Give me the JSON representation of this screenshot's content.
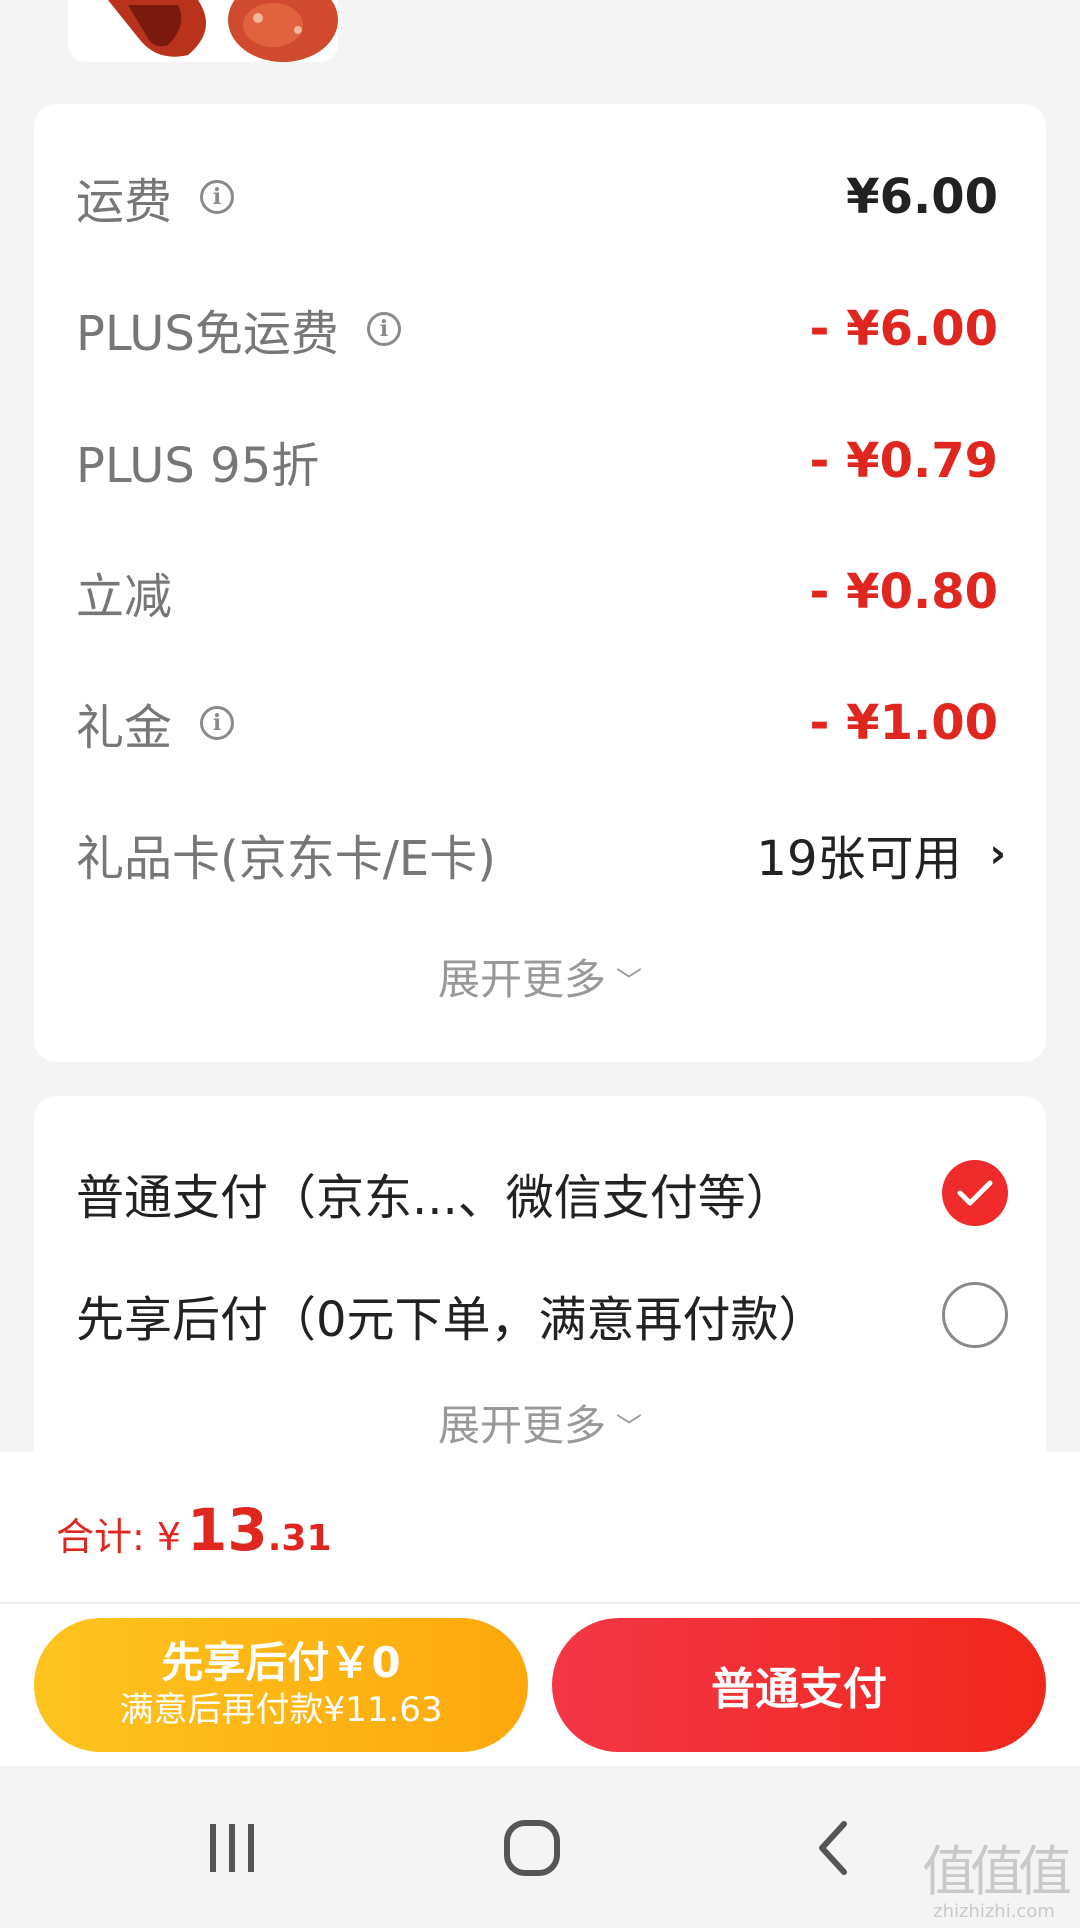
{
  "fees": [
    {
      "label": "运费",
      "info": true,
      "value": "¥6.00",
      "red": false
    },
    {
      "label": "PLUS免运费",
      "info": true,
      "value": "- ¥6.00",
      "red": true
    },
    {
      "label": "PLUS 95折",
      "info": false,
      "value": "- ¥0.79",
      "red": true
    },
    {
      "label": "立减",
      "info": false,
      "value": "- ¥0.80",
      "red": true
    },
    {
      "label": "礼金",
      "info": true,
      "value": "- ¥1.00",
      "red": true
    }
  ],
  "gift_card": {
    "label": "礼品卡(京东卡/E卡)",
    "value": "19张可用"
  },
  "expand_more_label": "展开更多",
  "payment_options": [
    {
      "label": "普通支付（京东...、微信支付等）",
      "selected": true
    },
    {
      "label": "先享后付（0元下单，满意再付款）",
      "selected": false
    }
  ],
  "total": {
    "label": "合计:",
    "currency": "¥",
    "integer": "13",
    "decimal": ".31"
  },
  "buttons": {
    "pay_later_title": "先享后付￥0",
    "pay_later_subtitle": "满意后再付款¥11.63",
    "normal_pay": "普通支付"
  },
  "watermark": {
    "mark": "值值值",
    "url": "zhizhizhi.com"
  },
  "colors": {
    "accent_red": "#e0271f",
    "button_yellow": "#fdb816",
    "button_red": "#f1303a"
  }
}
